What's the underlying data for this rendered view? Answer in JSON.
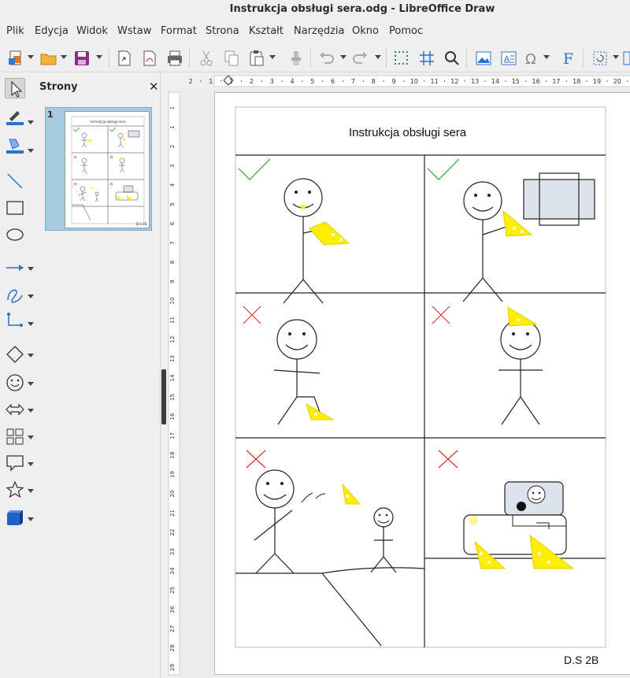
{
  "window": {
    "title": "Instrukcja obsługi sera.odg - LibreOffice Draw"
  },
  "menu": {
    "items": [
      "Plik",
      "Edycja",
      "Widok",
      "Wstaw",
      "Format",
      "Strona",
      "Kształt",
      "Narzędzia",
      "Okno",
      "Pomoc"
    ]
  },
  "toolbar": {
    "icons": [
      "new-icon",
      "open-icon",
      "save-icon",
      "export-icon",
      "export-pdf-icon",
      "print-icon",
      "cut-icon",
      "copy-icon",
      "paste-icon",
      "clone-formatting-icon",
      "undo-icon",
      "redo-icon",
      "grid-icon",
      "helplines-icon",
      "zoom-icon",
      "image-icon",
      "textbox-icon",
      "special-character-icon",
      "fontwork-icon",
      "transformations-icon"
    ]
  },
  "sidebar_tools": {
    "icons": [
      "select-icon",
      "line-color-icon",
      "fill-color-icon",
      "line-icon",
      "rectangle-icon",
      "ellipse-icon",
      "arrow-line-icon",
      "curve-icon",
      "connector-icon",
      "basic-shapes-icon",
      "symbol-shapes-icon",
      "block-arrows-icon",
      "flowchart-icon",
      "callouts-icon",
      "stars-icon",
      "3d-objects-icon"
    ]
  },
  "pages_panel": {
    "title": "Strony",
    "pages": [
      {
        "number": "1"
      }
    ]
  },
  "ruler": {
    "horizontal": [
      "2",
      "1",
      "1",
      "2",
      "3",
      "4",
      "5",
      "6",
      "7",
      "8",
      "9",
      "10",
      "11",
      "12",
      "13",
      "14",
      "15",
      "16",
      "17",
      "18",
      "19",
      "20"
    ],
    "vertical": [
      "1",
      "1",
      "2",
      "3",
      "4",
      "5",
      "6",
      "7",
      "8",
      "9",
      "10",
      "11",
      "12",
      "13",
      "14",
      "15",
      "16",
      "17",
      "18",
      "19",
      "20",
      "21",
      "22",
      "23",
      "24",
      "25",
      "26",
      "27",
      "28",
      "29"
    ]
  },
  "document": {
    "title": "Instrukcja obsługi sera",
    "footer": "D.S 2B"
  },
  "colors": {
    "cheese": "#ffee00",
    "check": "#2aa52a",
    "cross": "#e03030",
    "selection": "#a6cbe0"
  }
}
